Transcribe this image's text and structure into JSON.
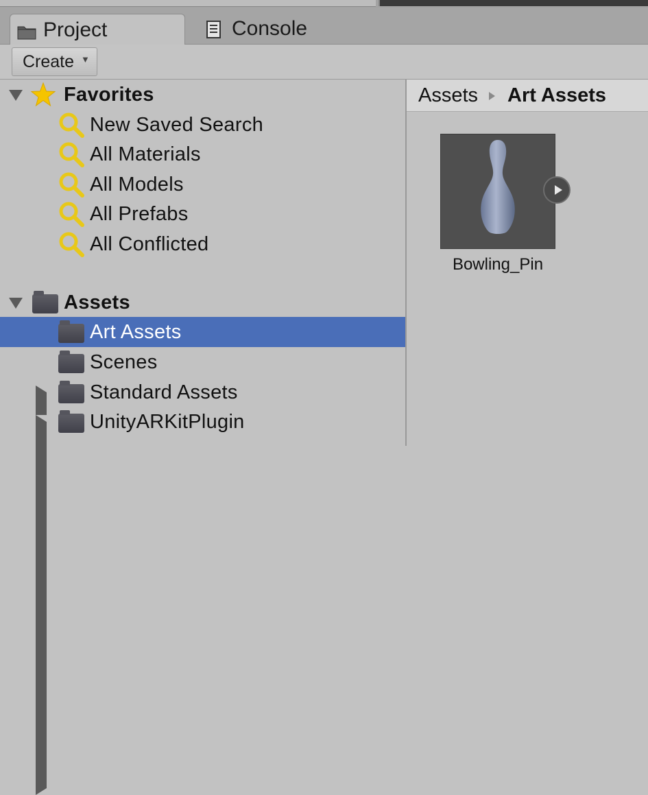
{
  "tabs": [
    {
      "label": "Project",
      "icon": "folder-icon",
      "active": true
    },
    {
      "label": "Console",
      "icon": "console-icon",
      "active": false
    }
  ],
  "toolbar": {
    "create_label": "Create"
  },
  "favorites": {
    "label": "Favorites",
    "items": [
      {
        "label": "New Saved Search",
        "icon": "search-icon"
      },
      {
        "label": "All Materials",
        "icon": "search-icon"
      },
      {
        "label": "All Models",
        "icon": "search-icon"
      },
      {
        "label": "All Prefabs",
        "icon": "search-icon"
      },
      {
        "label": "All Conflicted",
        "icon": "search-icon"
      }
    ]
  },
  "assets": {
    "label": "Assets",
    "items": [
      {
        "label": "Art Assets",
        "selected": true,
        "expandable": false
      },
      {
        "label": "Scenes",
        "selected": false,
        "expandable": false
      },
      {
        "label": "Standard Assets",
        "selected": false,
        "expandable": true
      },
      {
        "label": "UnityARKitPlugin",
        "selected": false,
        "expandable": true
      }
    ]
  },
  "breadcrumb": {
    "root": "Assets",
    "current": "Art Assets"
  },
  "grid": {
    "items": [
      {
        "label": "Bowling_Pin",
        "icon": "bowling-pin-thumbnail"
      }
    ]
  },
  "colors": {
    "selection": "#4a6eb8",
    "star": "#f5c400",
    "search_icon": "#e8c818"
  }
}
